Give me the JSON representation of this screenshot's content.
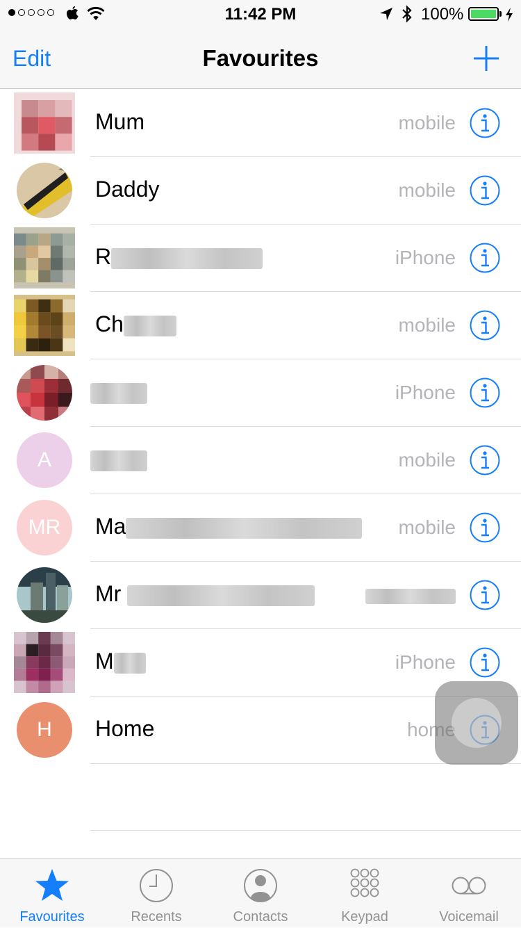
{
  "status_bar": {
    "time": "11:42 PM",
    "battery": "100%"
  },
  "nav": {
    "edit_label": "Edit",
    "title": "Favourites"
  },
  "favourites": [
    {
      "name": "Mum",
      "label": "mobile"
    },
    {
      "name": "Daddy",
      "label": "mobile"
    },
    {
      "name": "R",
      "label": "iPhone"
    },
    {
      "name": "Ch",
      "label": "mobile"
    },
    {
      "name": "",
      "label": "iPhone"
    },
    {
      "name": "",
      "label": "mobile",
      "initials": "A"
    },
    {
      "name": "Ma",
      "label": "mobile",
      "initials": "MR"
    },
    {
      "name": "Mr",
      "label": ""
    },
    {
      "name": "M",
      "label": "iPhone"
    },
    {
      "name": "Home",
      "label": "home",
      "initials": "H"
    }
  ],
  "tabs": [
    {
      "label": "Favourites",
      "icon": "star-icon",
      "active": true
    },
    {
      "label": "Recents",
      "icon": "clock-icon",
      "active": false
    },
    {
      "label": "Contacts",
      "icon": "contact-silhouette-icon",
      "active": false
    },
    {
      "label": "Keypad",
      "icon": "keypad-icon",
      "active": false
    },
    {
      "label": "Voicemail",
      "icon": "voicemail-icon",
      "active": false
    }
  ],
  "colors": {
    "accent": "#147efb",
    "secondary_text": "#b4b4b8",
    "battery": "#4cd964"
  }
}
